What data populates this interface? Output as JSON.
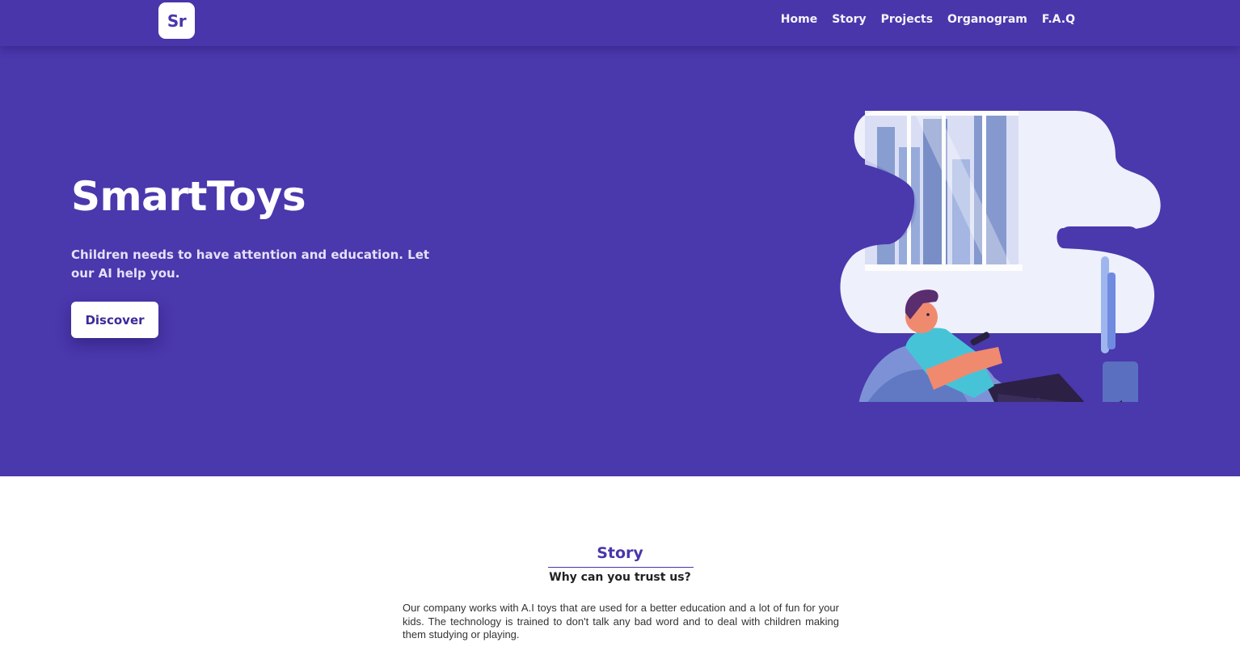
{
  "navbar": {
    "logo_text": "Sr",
    "links": [
      "Home",
      "Story",
      "Projects",
      "Organogram",
      "F.A.Q"
    ]
  },
  "hero": {
    "title": "SmartToys",
    "description": "Children needs to have attention and education. Let our AI help you.",
    "cta_label": "Discover",
    "illustration": "boy-on-beanbag-with-phone-illustration"
  },
  "story": {
    "title": "Story",
    "subtitle": "Why can you trust us?",
    "text": "Our company works with A.I toys that are used for a better education and a lot of fun for your kids. The technology is trained to don't talk any bad word and to deal with children making them studying or playing."
  },
  "colors": {
    "brand": "#4a36ab",
    "hero_bg": "#4a38ad",
    "white": "#ffffff"
  }
}
